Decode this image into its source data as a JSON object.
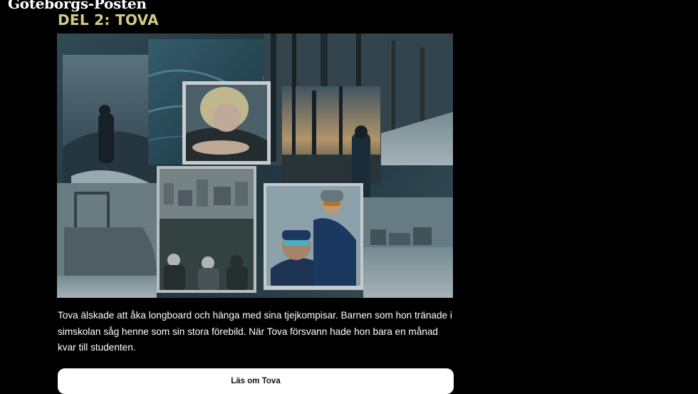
{
  "header": {
    "logo_text": "Göteborgs-Posten"
  },
  "article": {
    "section_title": "DEL 2: TOVA",
    "body": "Tova älskade att åka longboard och hänga med sina tjejkompisar. Barnen som hon tränade i simskolan såg henne som sin stora förebild. När Tova försvann hade hon bara en månad kvar till studenten.",
    "cta_label": "Läs om Tova"
  },
  "colors": {
    "background": "#000000",
    "title": "#d4c987",
    "button_bg": "#ffffff",
    "button_text": "#111111"
  }
}
